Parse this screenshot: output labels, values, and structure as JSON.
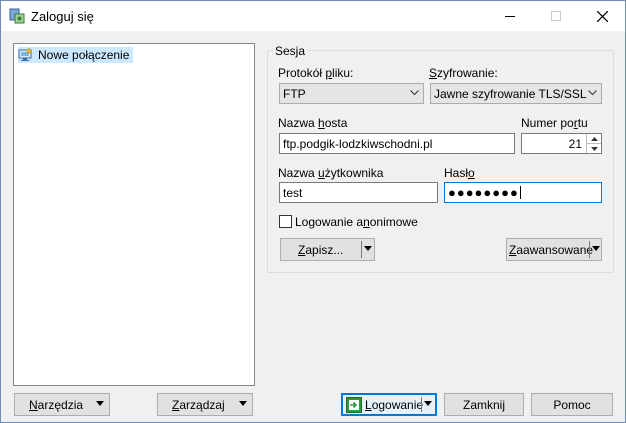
{
  "window": {
    "title": "Zaloguj się"
  },
  "sites": {
    "items": [
      {
        "label": "Nowe połączenie"
      }
    ]
  },
  "session": {
    "group_title": "Sesja",
    "protocol": {
      "label_pre": "Protokół ",
      "label_key": "p",
      "label_post": "liku:",
      "value": "FTP"
    },
    "encryption": {
      "label_pre": "",
      "label_key": "S",
      "label_post": "zyfrowanie:",
      "value": "Jawne szyfrowanie TLS/SSL"
    },
    "host": {
      "label_pre": "Nazwa ",
      "label_key": "h",
      "label_post": "osta",
      "value": "ftp.podgik-lodzkiwschodni.pl"
    },
    "port": {
      "label_pre": "Numer po",
      "label_key": "r",
      "label_post": "tu",
      "value": "21"
    },
    "user": {
      "label_pre": "Nazwa ",
      "label_key": "u",
      "label_post": "żytkownika",
      "value": "test"
    },
    "password": {
      "label_pre": "Hasł",
      "label_key": "o",
      "label_post": "",
      "masked_value": "●●●●●●●●"
    },
    "anonymous": {
      "label_pre": "Logowanie a",
      "label_key": "n",
      "label_post": "onimowe",
      "checked": false
    },
    "save_button": {
      "label_pre": "",
      "label_key": "Z",
      "label_post": "apisz..."
    },
    "advanced_button": {
      "label_pre": "",
      "label_key": "Z",
      "label_post": "aawansowane"
    }
  },
  "bottom": {
    "tools_button": {
      "label_pre": "",
      "label_key": "N",
      "label_post": "arzędzia"
    },
    "manage_button": {
      "label_pre": "",
      "label_key": "Z",
      "label_post": "arządzaj"
    },
    "login_button": {
      "label_pre": "",
      "label_key": "L",
      "label_post": "ogowanie"
    },
    "close_button": {
      "label": "Zamknij"
    },
    "help_button": {
      "label": "Pomoc"
    }
  },
  "icons": {
    "app": "winscp-app-icon",
    "minimize": "minimize-icon",
    "maximize": "maximize-icon",
    "close": "close-icon",
    "site": "new-site-icon",
    "login": "login-icon"
  }
}
